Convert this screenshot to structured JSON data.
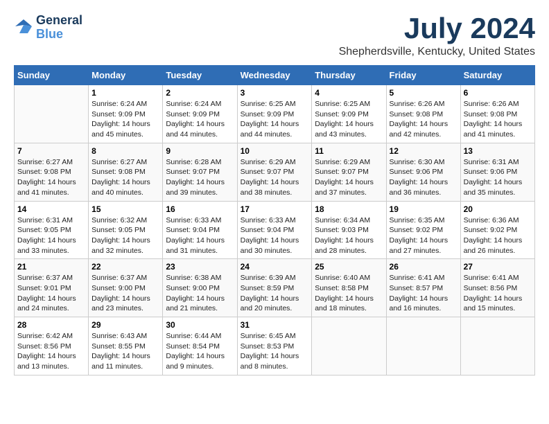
{
  "header": {
    "logo_line1": "General",
    "logo_line2": "Blue",
    "month_year": "July 2024",
    "location": "Shepherdsville, Kentucky, United States"
  },
  "days_of_week": [
    "Sunday",
    "Monday",
    "Tuesday",
    "Wednesday",
    "Thursday",
    "Friday",
    "Saturday"
  ],
  "weeks": [
    [
      {
        "day": "",
        "info": ""
      },
      {
        "day": "1",
        "info": "Sunrise: 6:24 AM\nSunset: 9:09 PM\nDaylight: 14 hours\nand 45 minutes."
      },
      {
        "day": "2",
        "info": "Sunrise: 6:24 AM\nSunset: 9:09 PM\nDaylight: 14 hours\nand 44 minutes."
      },
      {
        "day": "3",
        "info": "Sunrise: 6:25 AM\nSunset: 9:09 PM\nDaylight: 14 hours\nand 44 minutes."
      },
      {
        "day": "4",
        "info": "Sunrise: 6:25 AM\nSunset: 9:09 PM\nDaylight: 14 hours\nand 43 minutes."
      },
      {
        "day": "5",
        "info": "Sunrise: 6:26 AM\nSunset: 9:08 PM\nDaylight: 14 hours\nand 42 minutes."
      },
      {
        "day": "6",
        "info": "Sunrise: 6:26 AM\nSunset: 9:08 PM\nDaylight: 14 hours\nand 41 minutes."
      }
    ],
    [
      {
        "day": "7",
        "info": "Sunrise: 6:27 AM\nSunset: 9:08 PM\nDaylight: 14 hours\nand 41 minutes."
      },
      {
        "day": "8",
        "info": "Sunrise: 6:27 AM\nSunset: 9:08 PM\nDaylight: 14 hours\nand 40 minutes."
      },
      {
        "day": "9",
        "info": "Sunrise: 6:28 AM\nSunset: 9:07 PM\nDaylight: 14 hours\nand 39 minutes."
      },
      {
        "day": "10",
        "info": "Sunrise: 6:29 AM\nSunset: 9:07 PM\nDaylight: 14 hours\nand 38 minutes."
      },
      {
        "day": "11",
        "info": "Sunrise: 6:29 AM\nSunset: 9:07 PM\nDaylight: 14 hours\nand 37 minutes."
      },
      {
        "day": "12",
        "info": "Sunrise: 6:30 AM\nSunset: 9:06 PM\nDaylight: 14 hours\nand 36 minutes."
      },
      {
        "day": "13",
        "info": "Sunrise: 6:31 AM\nSunset: 9:06 PM\nDaylight: 14 hours\nand 35 minutes."
      }
    ],
    [
      {
        "day": "14",
        "info": "Sunrise: 6:31 AM\nSunset: 9:05 PM\nDaylight: 14 hours\nand 33 minutes."
      },
      {
        "day": "15",
        "info": "Sunrise: 6:32 AM\nSunset: 9:05 PM\nDaylight: 14 hours\nand 32 minutes."
      },
      {
        "day": "16",
        "info": "Sunrise: 6:33 AM\nSunset: 9:04 PM\nDaylight: 14 hours\nand 31 minutes."
      },
      {
        "day": "17",
        "info": "Sunrise: 6:33 AM\nSunset: 9:04 PM\nDaylight: 14 hours\nand 30 minutes."
      },
      {
        "day": "18",
        "info": "Sunrise: 6:34 AM\nSunset: 9:03 PM\nDaylight: 14 hours\nand 28 minutes."
      },
      {
        "day": "19",
        "info": "Sunrise: 6:35 AM\nSunset: 9:02 PM\nDaylight: 14 hours\nand 27 minutes."
      },
      {
        "day": "20",
        "info": "Sunrise: 6:36 AM\nSunset: 9:02 PM\nDaylight: 14 hours\nand 26 minutes."
      }
    ],
    [
      {
        "day": "21",
        "info": "Sunrise: 6:37 AM\nSunset: 9:01 PM\nDaylight: 14 hours\nand 24 minutes."
      },
      {
        "day": "22",
        "info": "Sunrise: 6:37 AM\nSunset: 9:00 PM\nDaylight: 14 hours\nand 23 minutes."
      },
      {
        "day": "23",
        "info": "Sunrise: 6:38 AM\nSunset: 9:00 PM\nDaylight: 14 hours\nand 21 minutes."
      },
      {
        "day": "24",
        "info": "Sunrise: 6:39 AM\nSunset: 8:59 PM\nDaylight: 14 hours\nand 20 minutes."
      },
      {
        "day": "25",
        "info": "Sunrise: 6:40 AM\nSunset: 8:58 PM\nDaylight: 14 hours\nand 18 minutes."
      },
      {
        "day": "26",
        "info": "Sunrise: 6:41 AM\nSunset: 8:57 PM\nDaylight: 14 hours\nand 16 minutes."
      },
      {
        "day": "27",
        "info": "Sunrise: 6:41 AM\nSunset: 8:56 PM\nDaylight: 14 hours\nand 15 minutes."
      }
    ],
    [
      {
        "day": "28",
        "info": "Sunrise: 6:42 AM\nSunset: 8:56 PM\nDaylight: 14 hours\nand 13 minutes."
      },
      {
        "day": "29",
        "info": "Sunrise: 6:43 AM\nSunset: 8:55 PM\nDaylight: 14 hours\nand 11 minutes."
      },
      {
        "day": "30",
        "info": "Sunrise: 6:44 AM\nSunset: 8:54 PM\nDaylight: 14 hours\nand 9 minutes."
      },
      {
        "day": "31",
        "info": "Sunrise: 6:45 AM\nSunset: 8:53 PM\nDaylight: 14 hours\nand 8 minutes."
      },
      {
        "day": "",
        "info": ""
      },
      {
        "day": "",
        "info": ""
      },
      {
        "day": "",
        "info": ""
      }
    ]
  ]
}
